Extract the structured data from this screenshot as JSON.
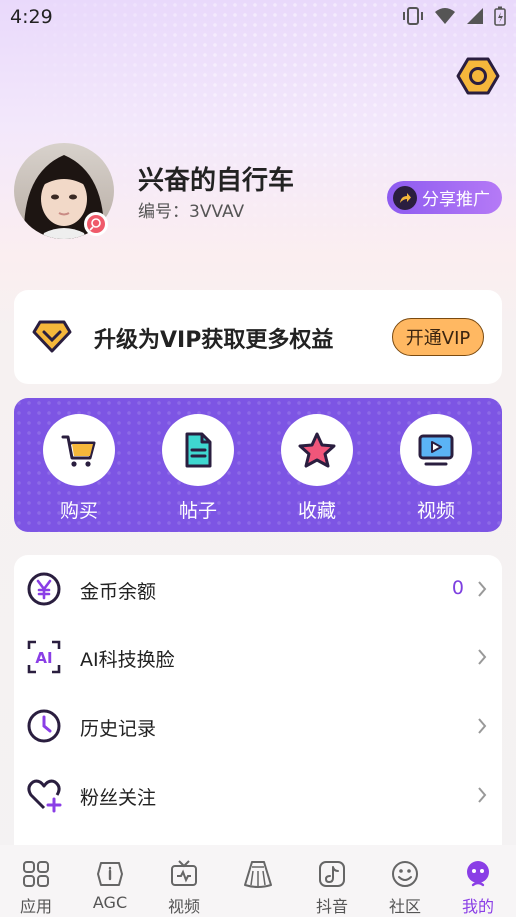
{
  "status_bar": {
    "time": "4:29"
  },
  "profile": {
    "username": "兴奋的自行车",
    "user_id_label": "编号：3VVAV",
    "share_label": "分享推广"
  },
  "vip": {
    "promo_text": "升级为VIP获取更多权益",
    "button_label": "开通VIP"
  },
  "quick_actions": [
    {
      "label": "购买",
      "icon": "cart-icon"
    },
    {
      "label": "帖子",
      "icon": "document-icon"
    },
    {
      "label": "收藏",
      "icon": "star-icon"
    },
    {
      "label": "视频",
      "icon": "video-icon"
    }
  ],
  "menu": [
    {
      "label": "金币余额",
      "value": "0",
      "icon": "yuan-coin-icon"
    },
    {
      "label": "AI科技换脸",
      "value": "",
      "icon": "ai-face-icon"
    },
    {
      "label": "历史记录",
      "value": "",
      "icon": "clock-icon"
    },
    {
      "label": "粉丝关注",
      "value": "",
      "icon": "heart-plus-icon"
    }
  ],
  "tabs": [
    {
      "label": "应用",
      "icon": "grid-icon"
    },
    {
      "label": "AGC",
      "icon": "agc-icon"
    },
    {
      "label": "视频",
      "icon": "tv-icon"
    },
    {
      "label": "",
      "icon": "skirt-icon"
    },
    {
      "label": "抖音",
      "icon": "tiktok-icon"
    },
    {
      "label": "社区",
      "icon": "community-icon"
    },
    {
      "label": "我的",
      "icon": "robot-icon",
      "active": true
    }
  ],
  "colors": {
    "accent": "#7d55e4",
    "vip_button": "#ffb862",
    "active_tab": "#8a3ee6"
  }
}
